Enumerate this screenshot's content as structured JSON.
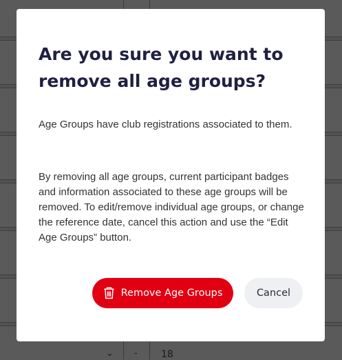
{
  "dialog": {
    "title": "Are you sure you want to remove all age groups?",
    "message": "Age Groups have club registrations associated to them.",
    "warning": "By removing all age groups, current participant badges and information associated to these age groups will be removed. To edit/remove individual age groups, or change the reference date, cancel this action and use the “Edit Age Groups” button.",
    "confirm_label": "Remove Age Groups",
    "confirm_icon": "trash-icon",
    "cancel_label": "Cancel"
  },
  "background_table": {
    "visible_row": {
      "dropdown_icon": "chevron-down-icon",
      "separator": "-",
      "value": "18"
    }
  },
  "colors": {
    "confirm": "#e00012",
    "cancel_bg": "#eef0f3",
    "title": "#1f2041",
    "overlay": "#5a5a5a"
  }
}
